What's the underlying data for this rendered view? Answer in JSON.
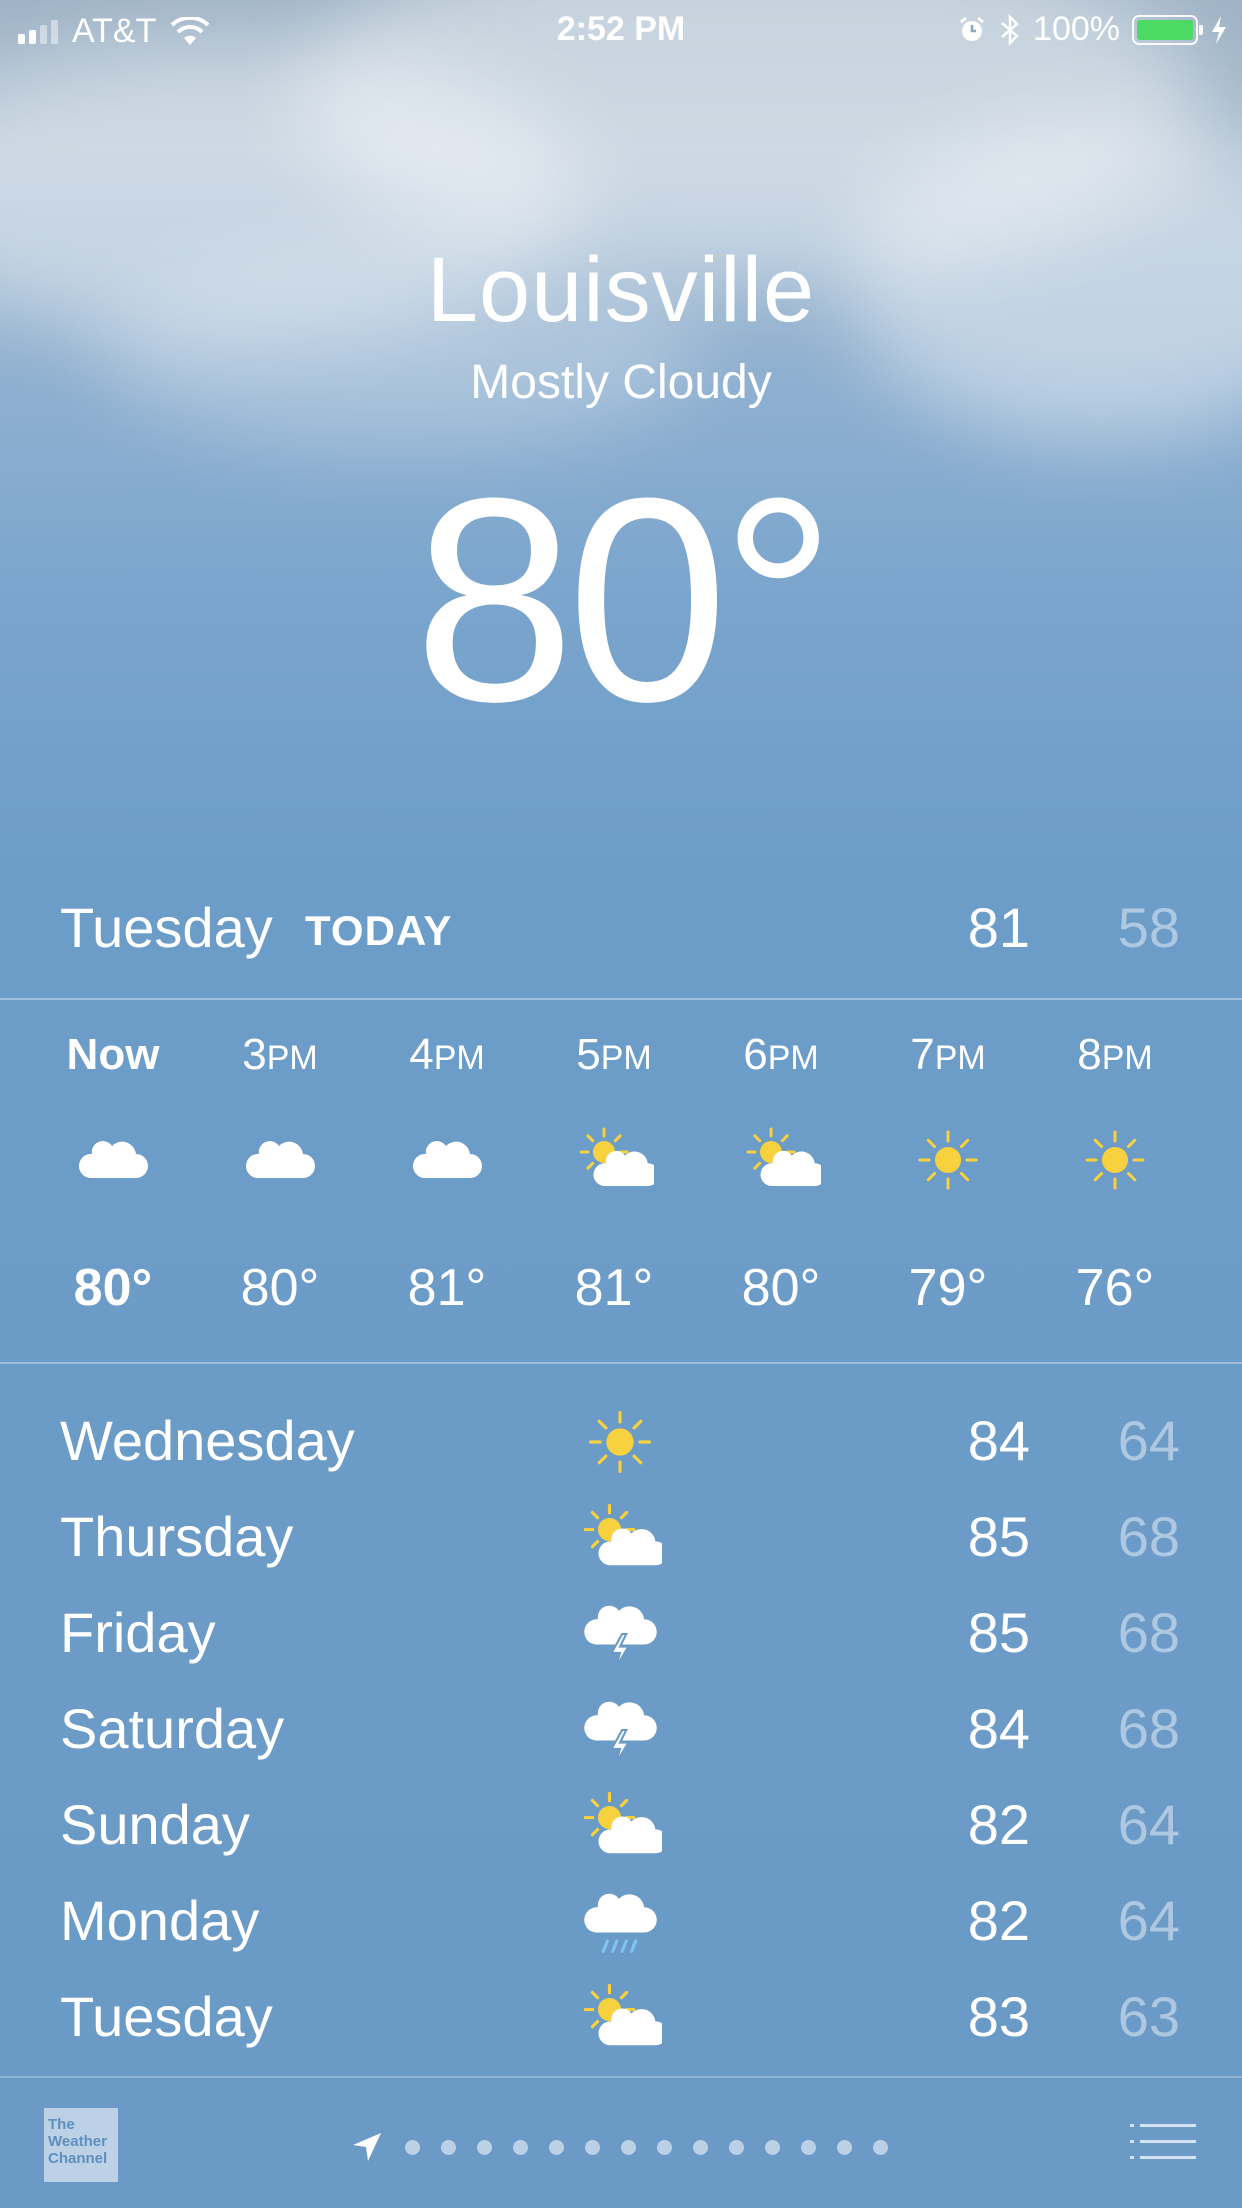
{
  "status_bar": {
    "carrier": "AT&T",
    "time": "2:52 PM",
    "battery": "100%"
  },
  "location": {
    "city": "Louisville",
    "condition": "Mostly Cloudy",
    "temperature": "80°"
  },
  "today": {
    "day": "Tuesday",
    "tag": "TODAY",
    "high": "81",
    "low": "58"
  },
  "hourly": [
    {
      "hour": "Now",
      "suffix": "",
      "icon": "cloud-icon",
      "temp": "80°"
    },
    {
      "hour": "3",
      "suffix": "PM",
      "icon": "cloud-icon",
      "temp": "80°"
    },
    {
      "hour": "4",
      "suffix": "PM",
      "icon": "cloud-icon",
      "temp": "81°"
    },
    {
      "hour": "5",
      "suffix": "PM",
      "icon": "partly-sunny-icon",
      "temp": "81°"
    },
    {
      "hour": "6",
      "suffix": "PM",
      "icon": "partly-sunny-icon",
      "temp": "80°"
    },
    {
      "hour": "7",
      "suffix": "PM",
      "icon": "sun-icon",
      "temp": "79°"
    },
    {
      "hour": "8",
      "suffix": "PM",
      "icon": "sun-icon",
      "temp": "76°"
    }
  ],
  "daily": [
    {
      "day": "Wednesday",
      "icon": "sun-icon",
      "high": "84",
      "low": "64"
    },
    {
      "day": "Thursday",
      "icon": "partly-sunny-icon",
      "high": "85",
      "low": "68"
    },
    {
      "day": "Friday",
      "icon": "thunderstorm-icon",
      "high": "85",
      "low": "68"
    },
    {
      "day": "Saturday",
      "icon": "thunderstorm-icon",
      "high": "84",
      "low": "68"
    },
    {
      "day": "Sunday",
      "icon": "partly-sunny-icon",
      "high": "82",
      "low": "64"
    },
    {
      "day": "Monday",
      "icon": "rain-icon",
      "high": "82",
      "low": "64"
    },
    {
      "day": "Tuesday",
      "icon": "partly-sunny-icon",
      "high": "83",
      "low": "63"
    }
  ],
  "bottom_bar": {
    "logo_text": "The Weather Channel",
    "page_count": 14
  },
  "colors": {
    "sun": "#f7d23e",
    "battery": "#4cd964",
    "rain": "#7fc3f5"
  }
}
